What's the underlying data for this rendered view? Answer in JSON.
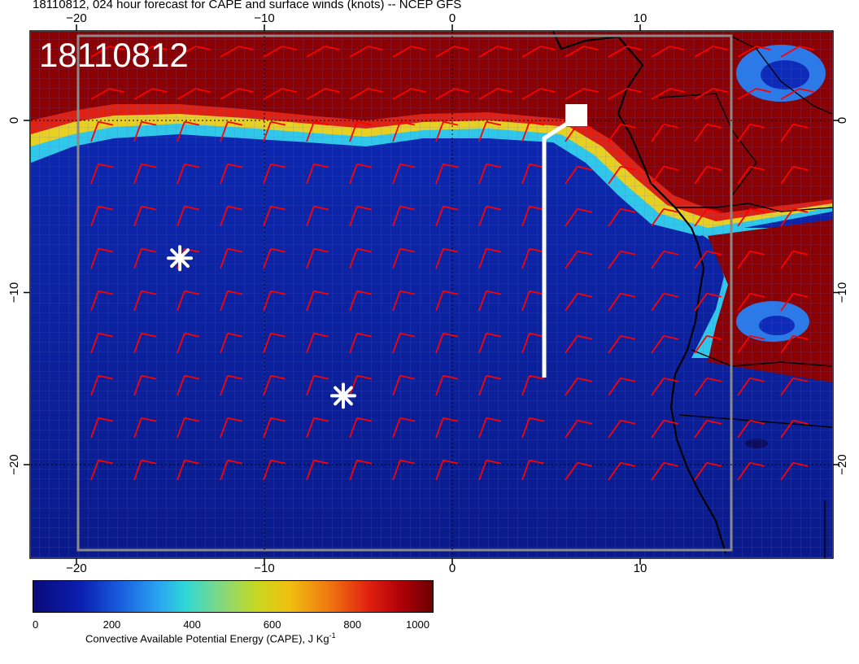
{
  "title": "18110812, 024 hour forecast for CAPE and surface winds (knots) -- NCEP GFS",
  "date_stamp": "18110812",
  "lon_ticks_top": [
    {
      "lon": -20,
      "label": "−20"
    },
    {
      "lon": -10,
      "label": "−10"
    },
    {
      "lon": 0,
      "label": "0"
    },
    {
      "lon": 10,
      "label": "10"
    }
  ],
  "lon_ticks_bottom": [
    {
      "lon": -20,
      "label": "−20"
    },
    {
      "lon": -10,
      "label": "−10"
    },
    {
      "lon": 0,
      "label": "0"
    },
    {
      "lon": 10,
      "label": "10"
    }
  ],
  "lat_ticks": [
    {
      "lat": 0,
      "label": "0"
    },
    {
      "lat": -10,
      "label": "−10"
    },
    {
      "lat": -20,
      "label": "−20"
    }
  ],
  "colorbar": {
    "min": 0,
    "max": 1000,
    "tick_labels": [
      "0",
      "200",
      "400",
      "600",
      "800",
      "1000"
    ],
    "label_prefix": "Convective Available Potential Energy (CAPE), J Kg",
    "label_superscript": "-1"
  },
  "markers": [
    {
      "type": "asterisk",
      "lon": -14.5,
      "lat": -8
    },
    {
      "type": "asterisk",
      "lon": -5.8,
      "lat": -16
    }
  ],
  "flight_track": {
    "color": "#ffffff"
  },
  "colors": {
    "cape_low": "#0b1a9a",
    "cape_high": "#8b0000",
    "wind_barb": "#ff0000",
    "coast": "#000000"
  }
}
